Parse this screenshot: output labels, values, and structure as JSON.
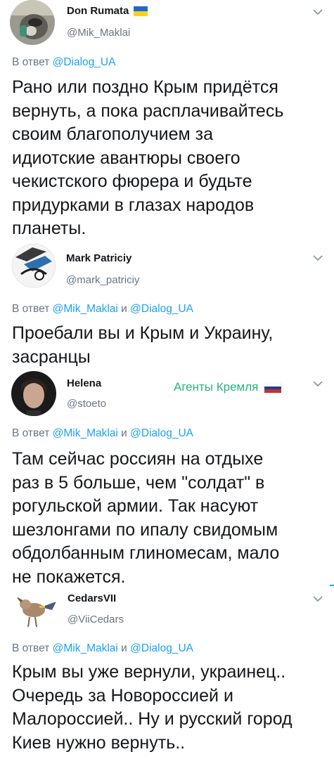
{
  "tweets": [
    {
      "name": "Don Rumata",
      "handle": "@Mik_Maklai",
      "flag": "ukraine",
      "reply_prefix": "В ответ",
      "reply_mentions": [
        "@Dialog_UA"
      ],
      "reply_joiner": "",
      "text": "Рано или поздно Крым придётся\nвернуть, а пока расплачивайтесь\nсвоим благополучием за\nидиотские авантюры своего\nчекистского фюрера и будьте\nпридурками в глазах народов\nпланеты."
    },
    {
      "name": "Mark Patriciy",
      "handle": "@mark_patriciy",
      "reply_prefix": "В ответ",
      "reply_mentions": [
        "@Mik_Maklai",
        "@Dialog_UA"
      ],
      "reply_joiner": "и",
      "text": "Проебали вы и Крым и Украину,\nзасранцы"
    },
    {
      "name": "Helena",
      "handle": "@stoeto",
      "annotation": "Агенты Кремля",
      "annotation_flag": "russia",
      "reply_prefix": "В ответ",
      "reply_mentions": [
        "@Mik_Maklai",
        "@Dialog_UA"
      ],
      "reply_joiner": "и",
      "text": "Там сейчас россиян на отдыхе\nраз в 5 больше, чем \"солдат\" в\nрогульской армии. Так насуют\nшезлонгами по ипалу  свидомым\nобдолбанным глиномесам, мало\nне покажется."
    },
    {
      "name": "CedarsVII",
      "handle": "@ViiCedars",
      "reply_prefix": "В ответ",
      "reply_mentions": [
        "@Mik_Maklai",
        "@Dialog_UA"
      ],
      "reply_joiner": "и",
      "text": "Крым вы уже вернули, украинец..\nОчередь за Новороссией и\nМалороссией.. Ну и русский город\nКиев нужно вернуть.."
    }
  ],
  "colors": {
    "text": "#14171a",
    "secondary": "#657786",
    "link": "#1da1f2",
    "annotation": "#27b47b"
  },
  "icons": [
    "chevron-down-icon",
    "ukraine-flag-icon",
    "russia-flag-icon"
  ]
}
